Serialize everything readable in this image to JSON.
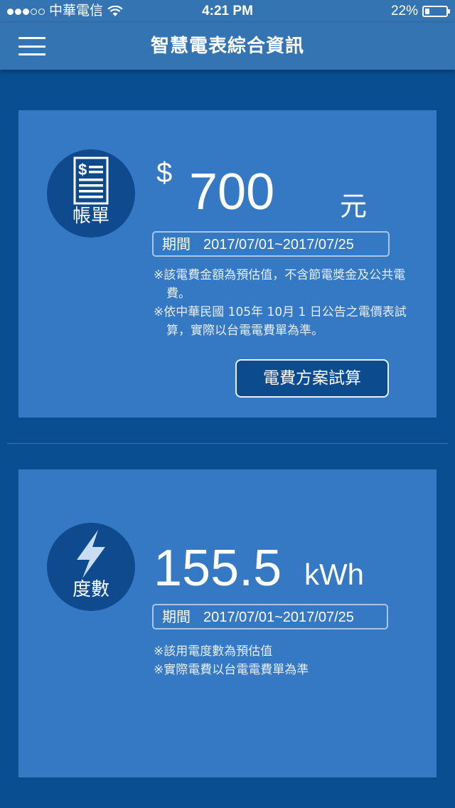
{
  "status_bar": {
    "carrier": "中華電信",
    "time": "4:21 PM",
    "battery_percent": "22%",
    "battery_level": 0.22,
    "signal_bars_filled": 3,
    "signal_bars_total": 5
  },
  "nav": {
    "title": "智慧電表綜合資訊",
    "menu_icon": "hamburger-menu-icon"
  },
  "bill_card": {
    "icon": "bill-document-icon",
    "icon_label": "帳單",
    "currency_symbol": "$",
    "amount": "700",
    "unit": "元",
    "period_label": "期間",
    "period_range": "2017/07/01~2017/07/25",
    "notes": [
      "※該電費金額為預估值，不含節電獎金及公共電費。",
      "※依中華民國 105年 10月 1 日公告之電價表試算，實際以台電電費單為準。"
    ],
    "button_label": "電費方案試算"
  },
  "usage_card": {
    "icon": "lightning-bolt-icon",
    "icon_label": "度數",
    "value": "155.5",
    "unit": "kWh",
    "period_label": "期間",
    "period_range": "2017/07/01~2017/07/25",
    "notes": [
      "※該用電度數為預估值",
      "※實際電費以台電電費單為準"
    ]
  },
  "colors": {
    "background": "#0a4e92",
    "header": "#3574b2",
    "card": "#3579c5",
    "icon_circle": "#0e4a8d",
    "button_bg": "#0d4b8f",
    "bolt": "#c9ddf2"
  }
}
